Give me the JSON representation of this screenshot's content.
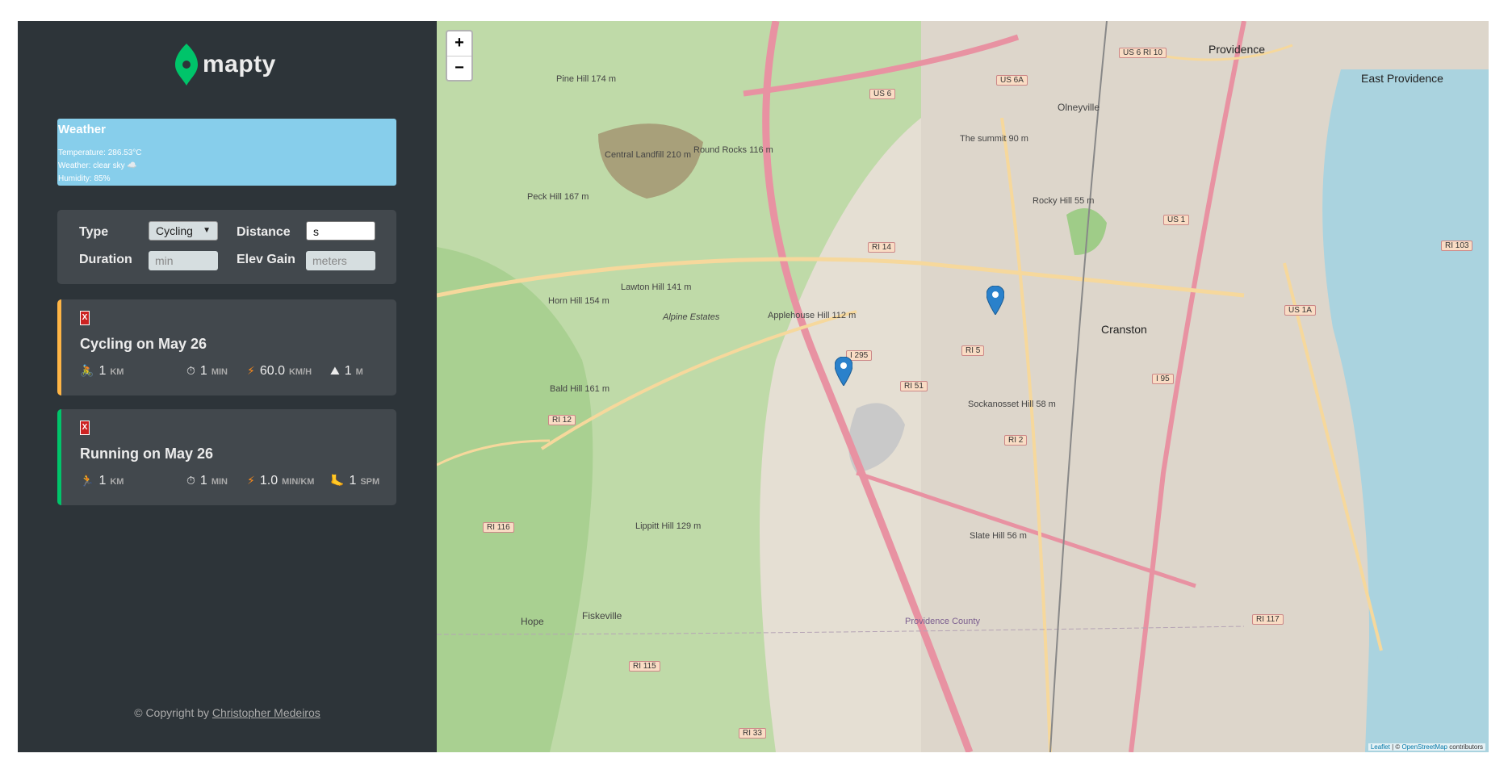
{
  "brand": {
    "name": "mapty"
  },
  "weather": {
    "title": "Weather",
    "temperature": "Temperature: 286.53°C",
    "condition": "Weather: clear sky ☁️",
    "humidity": "Humidity: 85%"
  },
  "form": {
    "type_label": "Type",
    "type_value": "Cycling",
    "distance_label": "Distance",
    "distance_value": "s",
    "duration_label": "Duration",
    "duration_placeholder": "min",
    "elev_label": "Elev Gain",
    "elev_placeholder": "meters"
  },
  "workouts": [
    {
      "title": "Cycling on May 26",
      "stripe_color": "#ffb545",
      "delete_label": "X",
      "distance": "1",
      "distance_unit": "KM",
      "distance_icon": "🚴",
      "duration": "1",
      "duration_unit": "MIN",
      "duration_icon": "⏱",
      "pace": "60.0",
      "pace_unit": "KM/H",
      "pace_icon": "⚡",
      "extra": "1",
      "extra_unit": "M",
      "extra_icon": "⛰"
    },
    {
      "title": "Running on May 26",
      "stripe_color": "#00c46a",
      "delete_label": "X",
      "distance": "1",
      "distance_unit": "KM",
      "distance_icon": "🏃",
      "duration": "1",
      "duration_unit": "MIN",
      "duration_icon": "⏱",
      "pace": "1.0",
      "pace_unit": "MIN/KM",
      "pace_icon": "⚡",
      "extra": "1",
      "extra_unit": "SPM",
      "extra_icon": "🦶"
    }
  ],
  "footer": {
    "prefix": "© Copyright by ",
    "author": "Christopher Medeiros"
  },
  "map": {
    "zoom_in": "+",
    "zoom_out": "−",
    "places": [
      "Providence",
      "East Providence",
      "Olneyville",
      "Cranston",
      "Fiskeville",
      "Hope",
      "Alpine Estates",
      "Providence County"
    ],
    "hills": [
      "Pine Hill 174 m",
      "Central Landfill 210 m",
      "Round Rocks 116 m",
      "Peck Hill 167 m",
      "Horn Hill 154 m",
      "Lawton Hill 141 m",
      "Applehouse Hill 112 m",
      "Bald Hill 161 m",
      "The summit 90 m",
      "Rocky Hill 55 m",
      "Sockanosset Hill 58 m",
      "Slate Hill 56 m",
      "Lippitt Hill 129 m"
    ],
    "roads": [
      "US 6",
      "US 6A",
      "RI 14",
      "I 295",
      "RI 51",
      "RI 5",
      "RI 2",
      "RI 12",
      "RI 116",
      "RI 115",
      "I 95",
      "US 1",
      "US 1A",
      "RI 117",
      "RI 103",
      "RI 33",
      "US 6 RI 10"
    ],
    "attribution_link": "Leaflet",
    "attribution_text": " | © ",
    "attribution_osm": "OpenStreetMap",
    "attribution_end": " contributors",
    "marker_color": "#2a81cb"
  }
}
